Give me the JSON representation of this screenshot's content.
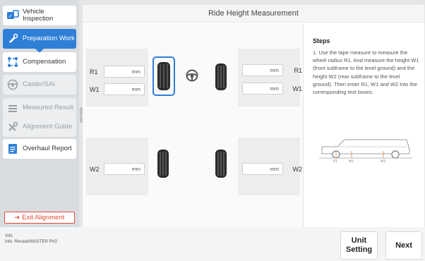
{
  "sidebar": {
    "items": [
      {
        "label": "Vehicle Inspection",
        "icon": "vehicle-inspection-icon",
        "state": "normal"
      },
      {
        "label": "Preparation Work",
        "icon": "preparation-icon",
        "state": "active"
      },
      {
        "label": "Compensation",
        "icon": "compensation-icon",
        "state": "normal"
      },
      {
        "label": "Caster/SAI",
        "icon": "steering-wheel-icon",
        "state": "disabled"
      },
      {
        "label": "Measured Result",
        "icon": "measured-result-icon",
        "state": "disabled"
      },
      {
        "label": "Alignment Guide",
        "icon": "wrench-icon",
        "state": "disabled"
      },
      {
        "label": "Overhaul Report",
        "icon": "report-icon",
        "state": "normal"
      }
    ],
    "exit_label": "Exit Alignment"
  },
  "header": {
    "title": "Ride Height Measurement"
  },
  "front": {
    "r1_label": "R1",
    "w1_label": "W1",
    "left_r1": "mm",
    "left_w1": "mm",
    "right_r1": "mm",
    "right_w1": "mm"
  },
  "rear": {
    "w2_label": "W2",
    "left_w2": "mm",
    "right_w2": "mm"
  },
  "steps": {
    "title": "Steps",
    "text": "1. Use the tape measure to measure the wheel radius R1. And measure the height W1 (front subframe to the level ground) and the height W2 (rear subframe to the level ground). Then enter R1, W1 and W2 into the corresponding text boxes.",
    "diagram_labels": [
      "R1",
      "W1",
      "W2"
    ]
  },
  "footer": {
    "vin_label": "VIN:",
    "info": "Info: Renault/MASTER PH2",
    "unit_setting": "Unit Setting",
    "next": "Next"
  },
  "colors": {
    "accent": "#2f7fd7",
    "exit": "#e24b3b"
  }
}
